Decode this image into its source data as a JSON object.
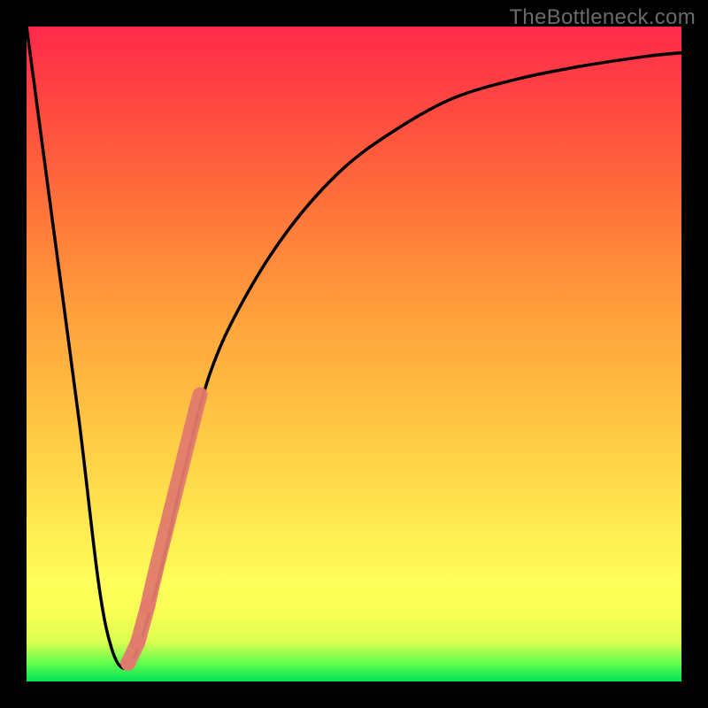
{
  "watermark": "TheBottleneck.com",
  "chart_data": {
    "type": "line",
    "title": "",
    "xlabel": "",
    "ylabel": "",
    "xlim": [
      0,
      100
    ],
    "ylim": [
      0,
      100
    ],
    "grid": false,
    "legend": false,
    "series": [
      {
        "name": "bottleneck-curve",
        "color": "#000000",
        "x": [
          0,
          4,
          8,
          11,
          13,
          15,
          17,
          20,
          24,
          28,
          33,
          40,
          48,
          56,
          65,
          75,
          85,
          95,
          100
        ],
        "y": [
          100,
          70,
          40,
          15,
          5,
          2,
          5,
          15,
          32,
          47,
          58,
          69,
          78,
          84,
          89,
          92,
          94,
          95.5,
          96
        ]
      }
    ],
    "markers": {
      "name": "highlight-segment",
      "color": "#e27a6d",
      "x": [
        15.5,
        17.0,
        18.5,
        19.0,
        19.5,
        20.0,
        20.5,
        21.0,
        21.5,
        22.0,
        22.5,
        23.0,
        23.5,
        24.0,
        24.5,
        25.0,
        25.5,
        26.0,
        26.5
      ],
      "y": [
        2.8,
        6.0,
        11.5,
        13.8,
        15.9,
        18.0,
        20.0,
        22.0,
        24.0,
        26.0,
        28.0,
        30.0,
        32.0,
        34.0,
        36.0,
        38.0,
        40.0,
        42.0,
        43.8
      ]
    }
  }
}
